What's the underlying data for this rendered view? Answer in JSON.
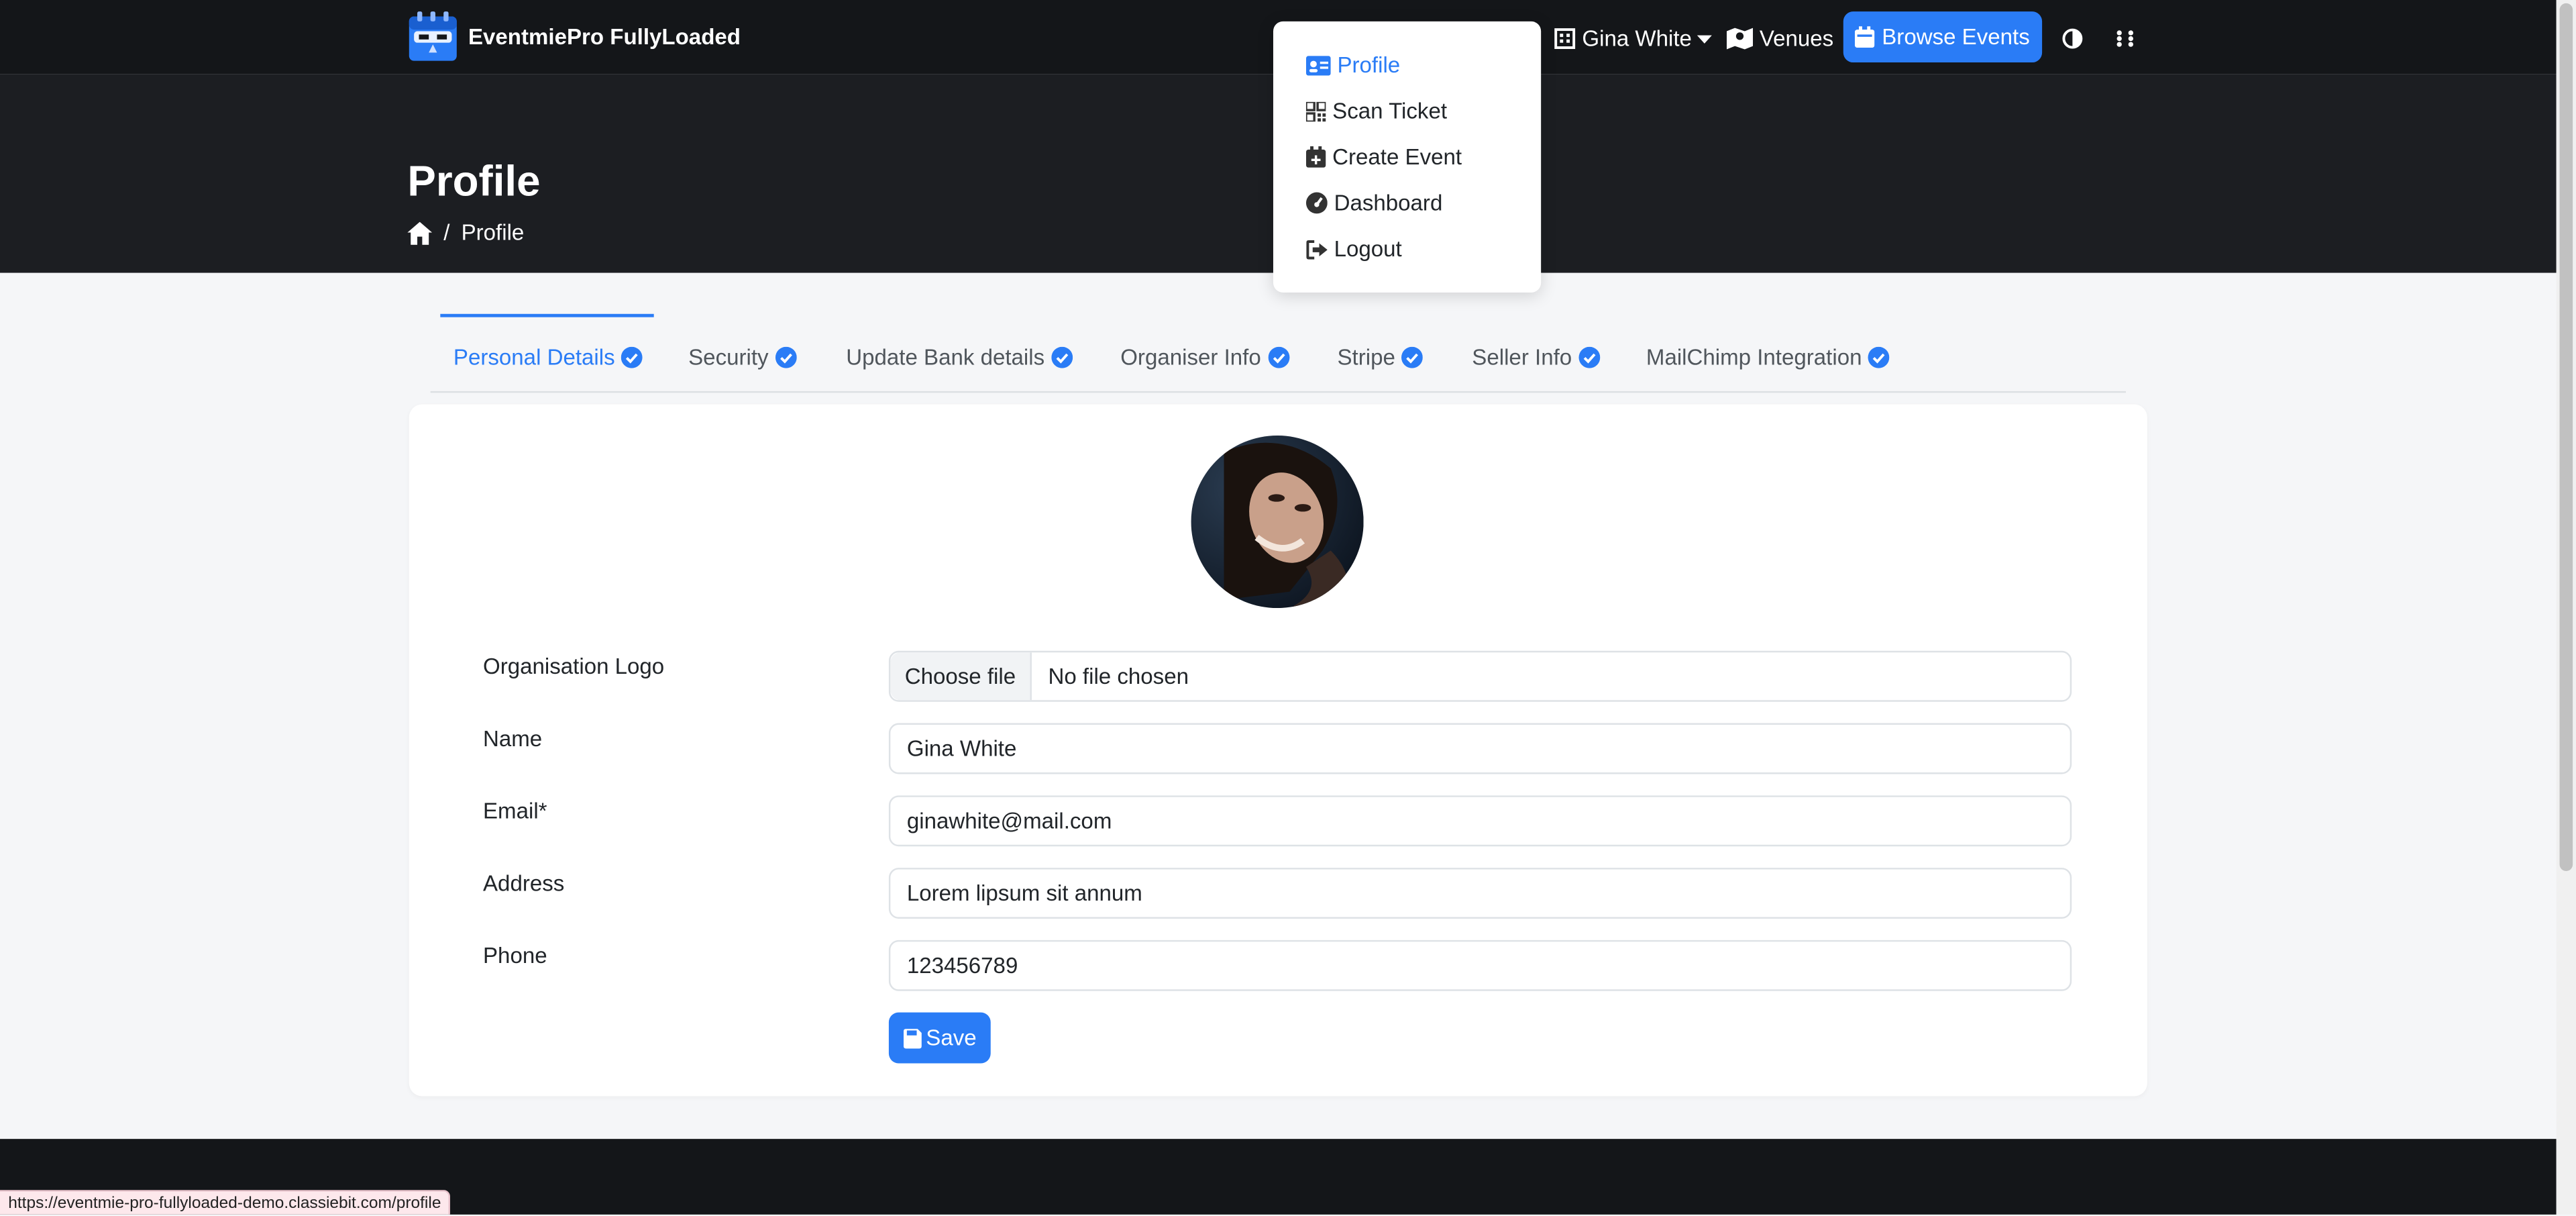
{
  "brand": {
    "name": "EventmiePro FullyLoaded",
    "logo_icon": "calendar-logo-icon"
  },
  "navbar": {
    "user_name": "Gina White",
    "venues_label": "Venues",
    "browse_events_label": "Browse Events",
    "theme_toggle_icon": "half-circle-icon",
    "apps_icon": "grid-icon"
  },
  "user_menu": {
    "items": [
      {
        "label": "Profile",
        "icon": "id-card-icon",
        "active": true
      },
      {
        "label": "Scan Ticket",
        "icon": "qrcode-icon",
        "active": false
      },
      {
        "label": "Create Event",
        "icon": "calendar-plus-icon",
        "active": false
      },
      {
        "label": "Dashboard",
        "icon": "gauge-icon",
        "active": false
      },
      {
        "label": "Logout",
        "icon": "logout-icon",
        "active": false
      }
    ]
  },
  "hero": {
    "title": "Profile",
    "breadcrumb": {
      "current": "Profile"
    }
  },
  "tabs": [
    {
      "label": "Personal Details",
      "active": true
    },
    {
      "label": "Security",
      "active": false
    },
    {
      "label": "Update Bank details",
      "active": false
    },
    {
      "label": "Organiser Info",
      "active": false
    },
    {
      "label": "Stripe",
      "active": false
    },
    {
      "label": "Seller Info",
      "active": false
    },
    {
      "label": "MailChimp Integration",
      "active": false
    }
  ],
  "form": {
    "logo_label": "Organisation Logo",
    "file_button": "Choose file",
    "file_status": "No file chosen",
    "name_label": "Name",
    "name_value": "Gina White",
    "email_label": "Email*",
    "email_value": "ginawhite@mail.com",
    "address_label": "Address",
    "address_value": "Lorem lipsum sit annum",
    "phone_label": "Phone",
    "phone_value": "123456789",
    "save_label": "Save"
  },
  "status_bar": {
    "url": "https://eventmie-pro-fullyloaded-demo.classiebit.com/profile"
  },
  "colors": {
    "accent": "#2a7cf6",
    "navbar": "#141619",
    "hero": "#1c1e22",
    "page_bg": "#f5f6f8"
  }
}
